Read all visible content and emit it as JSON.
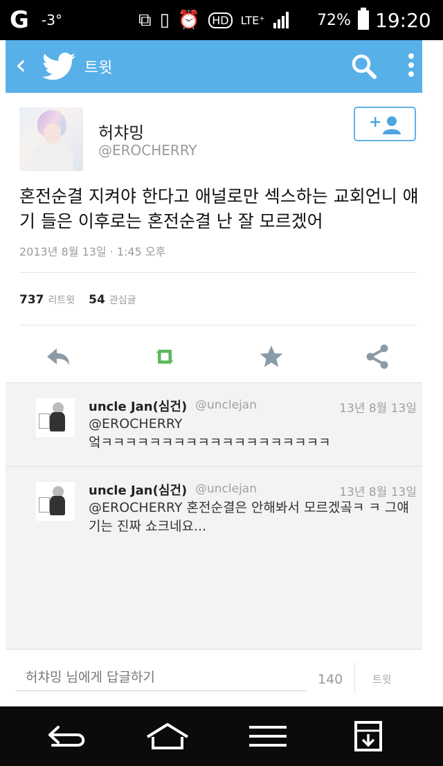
{
  "status": {
    "carrier": "G",
    "temperature": "-3°",
    "network": "LTE⁺",
    "battery": "72%",
    "time": "19:20"
  },
  "appbar": {
    "title": "트윗"
  },
  "tweet": {
    "author_name": "허챠밍",
    "author_handle": "@EROCHERRY",
    "text": "혼전순결 지켜야 한다고 애널로만 섹스하는 교회언니 얘기 들은 이후로는 혼전순결 난 잘 모르겠어",
    "timestamp": "2013년 8월 13일 · 1:45 오후",
    "retweets_count": "737",
    "retweets_label": "리트윗",
    "favorites_count": "54",
    "favorites_label": "관심글",
    "follow_plus": "+"
  },
  "replies": [
    {
      "name": "uncle Jan(심건)",
      "handle": "@unclejan",
      "date": "13년 8월 13일",
      "text": "@EROCHERRY\n엌ㅋㅋㅋㅋㅋㅋㅋㅋㅋㅋㅋㅋㅋㅋㅋㅋㅋㅋㅋ"
    },
    {
      "name": "uncle Jan(심건)",
      "handle": "@unclejan",
      "date": "13년 8월 13일",
      "text": "@EROCHERRY 혼전순결은 안해봐서 모르겠곸ㅋ ㅋ 그얘기는 진짜 쇼크네요..."
    }
  ],
  "compose": {
    "placeholder": "허챠밍 님에게 답글하기",
    "char_count": "140",
    "send_label": "트윗"
  },
  "colors": {
    "appbar": "#58b0e8",
    "retweet_green": "#5cb85c",
    "action_gray": "#8a9ba8"
  }
}
